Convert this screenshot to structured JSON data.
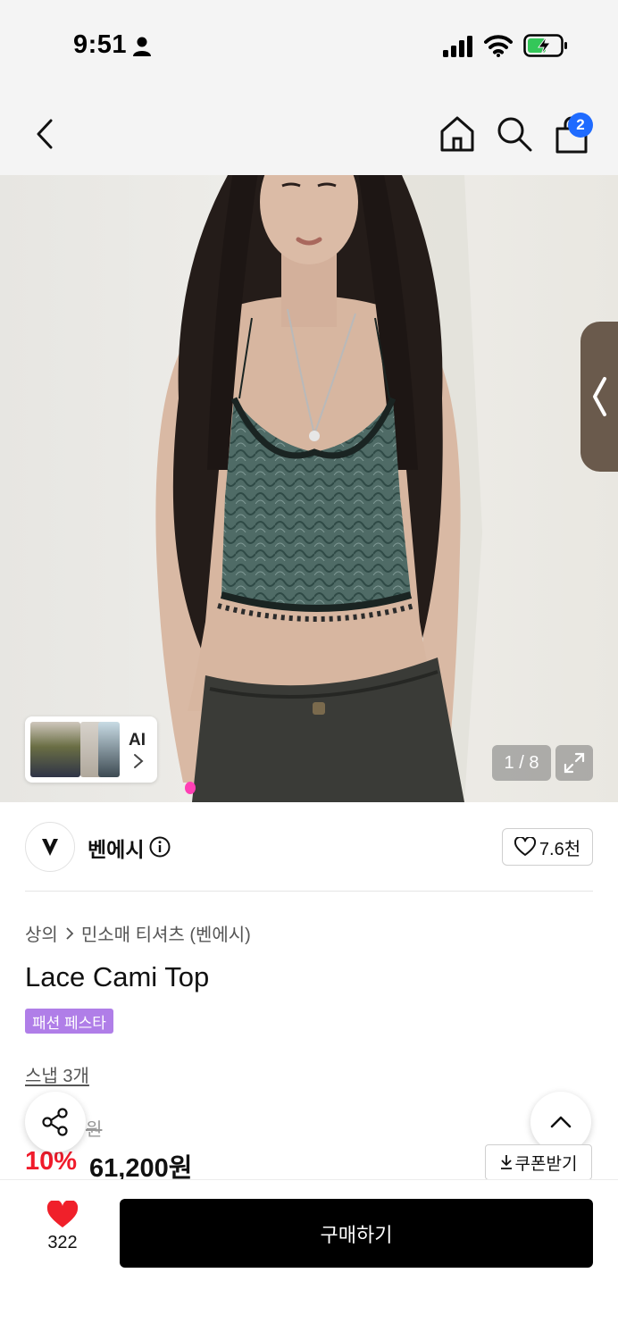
{
  "status_bar": {
    "time": "9:51"
  },
  "header": {
    "cart_count": "2"
  },
  "gallery": {
    "ai_label": "AI",
    "page_indicator": "1 / 8"
  },
  "brand": {
    "name": "벤에시",
    "likes": "7.6천"
  },
  "product": {
    "breadcrumb": [
      "상의",
      "민소매 티셔츠 (벤에시)"
    ],
    "title": "Lace Cami Top",
    "event_badge": "패션 페스타",
    "snap_link": "스냅 3개",
    "original_price_fragment": "원",
    "discount": "10%",
    "sale_price": "61,200원",
    "coupon_label": "쿠폰받기"
  },
  "bottom_bar": {
    "wish_count": "322",
    "buy_label": "구매하기"
  },
  "colors": {
    "accent_blue": "#1f6bff",
    "discount_red": "#f01b2b",
    "badge_purple": "#b07ee8",
    "heart_red": "#f0202a",
    "buy_black": "#000000"
  }
}
